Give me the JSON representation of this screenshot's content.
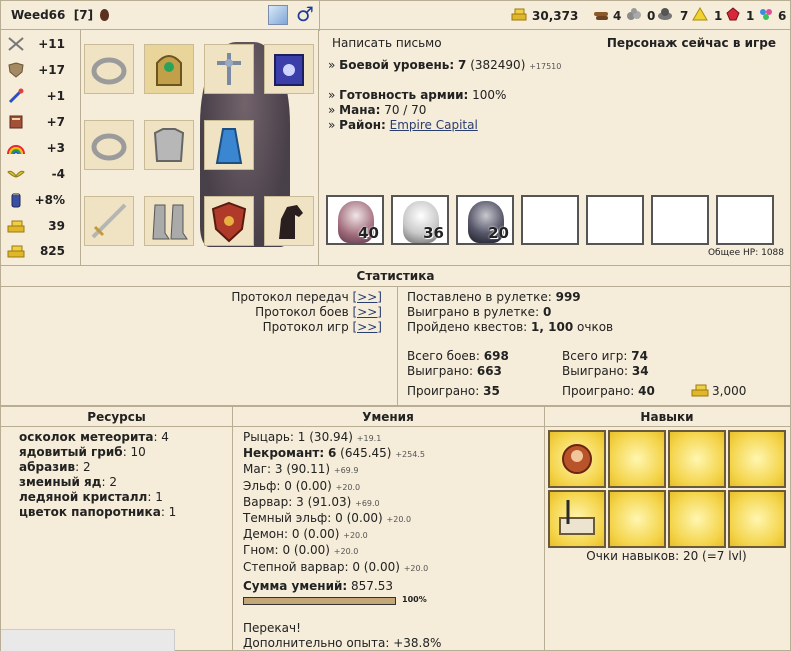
{
  "header": {
    "name": "Weed66",
    "level": "[7]",
    "gold": "30,373",
    "wood": "4",
    "ore": "0",
    "mercury": "7",
    "sulfur": "1",
    "crystals": "1",
    "gems": "6"
  },
  "stats": [
    {
      "icon": "swords-icon",
      "value": "+11"
    },
    {
      "icon": "shield-icon",
      "value": "+17"
    },
    {
      "icon": "wand-icon",
      "value": "+1"
    },
    {
      "icon": "book-icon",
      "value": "+7"
    },
    {
      "icon": "rainbow-icon",
      "value": "+3"
    },
    {
      "icon": "wings-icon",
      "value": "-4"
    },
    {
      "icon": "jar-icon",
      "value": "+8%"
    },
    {
      "icon": "gold-icon",
      "value": "39"
    },
    {
      "icon": "gold-icon",
      "value": "825"
    }
  ],
  "info": {
    "write_letter": "Написать письмо",
    "online_status": "Персонаж сейчас в игре",
    "combat_level_label": "Боевой уровень:",
    "combat_level": "7",
    "experience": "(382490)",
    "experience_delta": "+17510",
    "army_ready_label": "Готовность армии:",
    "army_ready": "100%",
    "mana_label": "Мана:",
    "mana": "70 / 70",
    "district_label": "Район:",
    "district": "Empire Capital",
    "total_hp": "Общее HP: 1088"
  },
  "army": [
    {
      "name": "unit-knight",
      "count": "40"
    },
    {
      "name": "unit-skeleton",
      "count": "36"
    },
    {
      "name": "unit-vampire",
      "count": "20"
    }
  ],
  "statistics": {
    "title": "Статистика",
    "protocols": [
      {
        "label": "Протокол передач",
        "link": "[>>]"
      },
      {
        "label": "Протокол боев",
        "link": "[>>]"
      },
      {
        "label": "Протокол игр",
        "link": "[>>]"
      }
    ],
    "roulette_bet_label": "Поставлено в рулетке:",
    "roulette_bet": "999",
    "roulette_won_label": "Выиграно в рулетке:",
    "roulette_won": "0",
    "quests_label": "Пройдено квестов:",
    "quests": "1, 100",
    "quests_suffix": "очков",
    "battles_total_label": "Всего боев:",
    "battles_total": "698",
    "battles_won_label": "Выиграно:",
    "battles_won": "663",
    "battles_lost_label": "Проиграно:",
    "battles_lost": "35",
    "games_total_label": "Всего игр:",
    "games_total": "74",
    "games_won_label": "Выиграно:",
    "games_won": "34",
    "games_lost_label": "Проиграно:",
    "games_lost": "40",
    "games_gold": "3,000"
  },
  "resources": {
    "title": "Ресурсы",
    "items": [
      {
        "name": "осколок метеорита",
        "count": "4"
      },
      {
        "name": "ядовитый гриб",
        "count": "10"
      },
      {
        "name": "абразив",
        "count": "2"
      },
      {
        "name": "змеиный яд",
        "count": "2"
      },
      {
        "name": "ледяной кристалл",
        "count": "1"
      },
      {
        "name": "цветок папоротника",
        "count": "1"
      }
    ]
  },
  "skills": {
    "title": "Умения",
    "items": [
      {
        "name": "Рыцарь:",
        "value": "1 (30.94)",
        "delta": "+19.1",
        "bold": false
      },
      {
        "name": "Некромант:",
        "value": "6",
        "extra": "(645.45)",
        "delta": "+254.5",
        "bold": true
      },
      {
        "name": "Маг:",
        "value": "3 (90.11)",
        "delta": "+69.9",
        "bold": false
      },
      {
        "name": "Эльф:",
        "value": "0 (0.00)",
        "delta": "+20.0",
        "bold": false
      },
      {
        "name": "Варвар:",
        "value": "3 (91.03)",
        "delta": "+69.0",
        "bold": false
      },
      {
        "name": "Темный эльф:",
        "value": "0 (0.00)",
        "delta": "+20.0",
        "bold": false
      },
      {
        "name": "Демон:",
        "value": "0 (0.00)",
        "delta": "+20.0",
        "bold": false
      },
      {
        "name": "Гном:",
        "value": "0 (0.00)",
        "delta": "+20.0",
        "bold": false
      },
      {
        "name": "Степной варвар:",
        "value": "0 (0.00)",
        "delta": "+20.0",
        "bold": false
      }
    ],
    "sum_label": "Сумма умений:",
    "sum": "857.53",
    "progress": "100%",
    "progress_value": 100,
    "overload": "Перекач!",
    "extra_exp": "Дополнительно опыта: +38.8%"
  },
  "talents": {
    "title": "Навыки",
    "points": "Очки навыков: 20 (=7 lvl)"
  },
  "colors": {
    "bg": "#f5ecd9",
    "border": "#b9ae93",
    "skill_cell": "#f4d44a",
    "link": "#2a3d6f"
  }
}
